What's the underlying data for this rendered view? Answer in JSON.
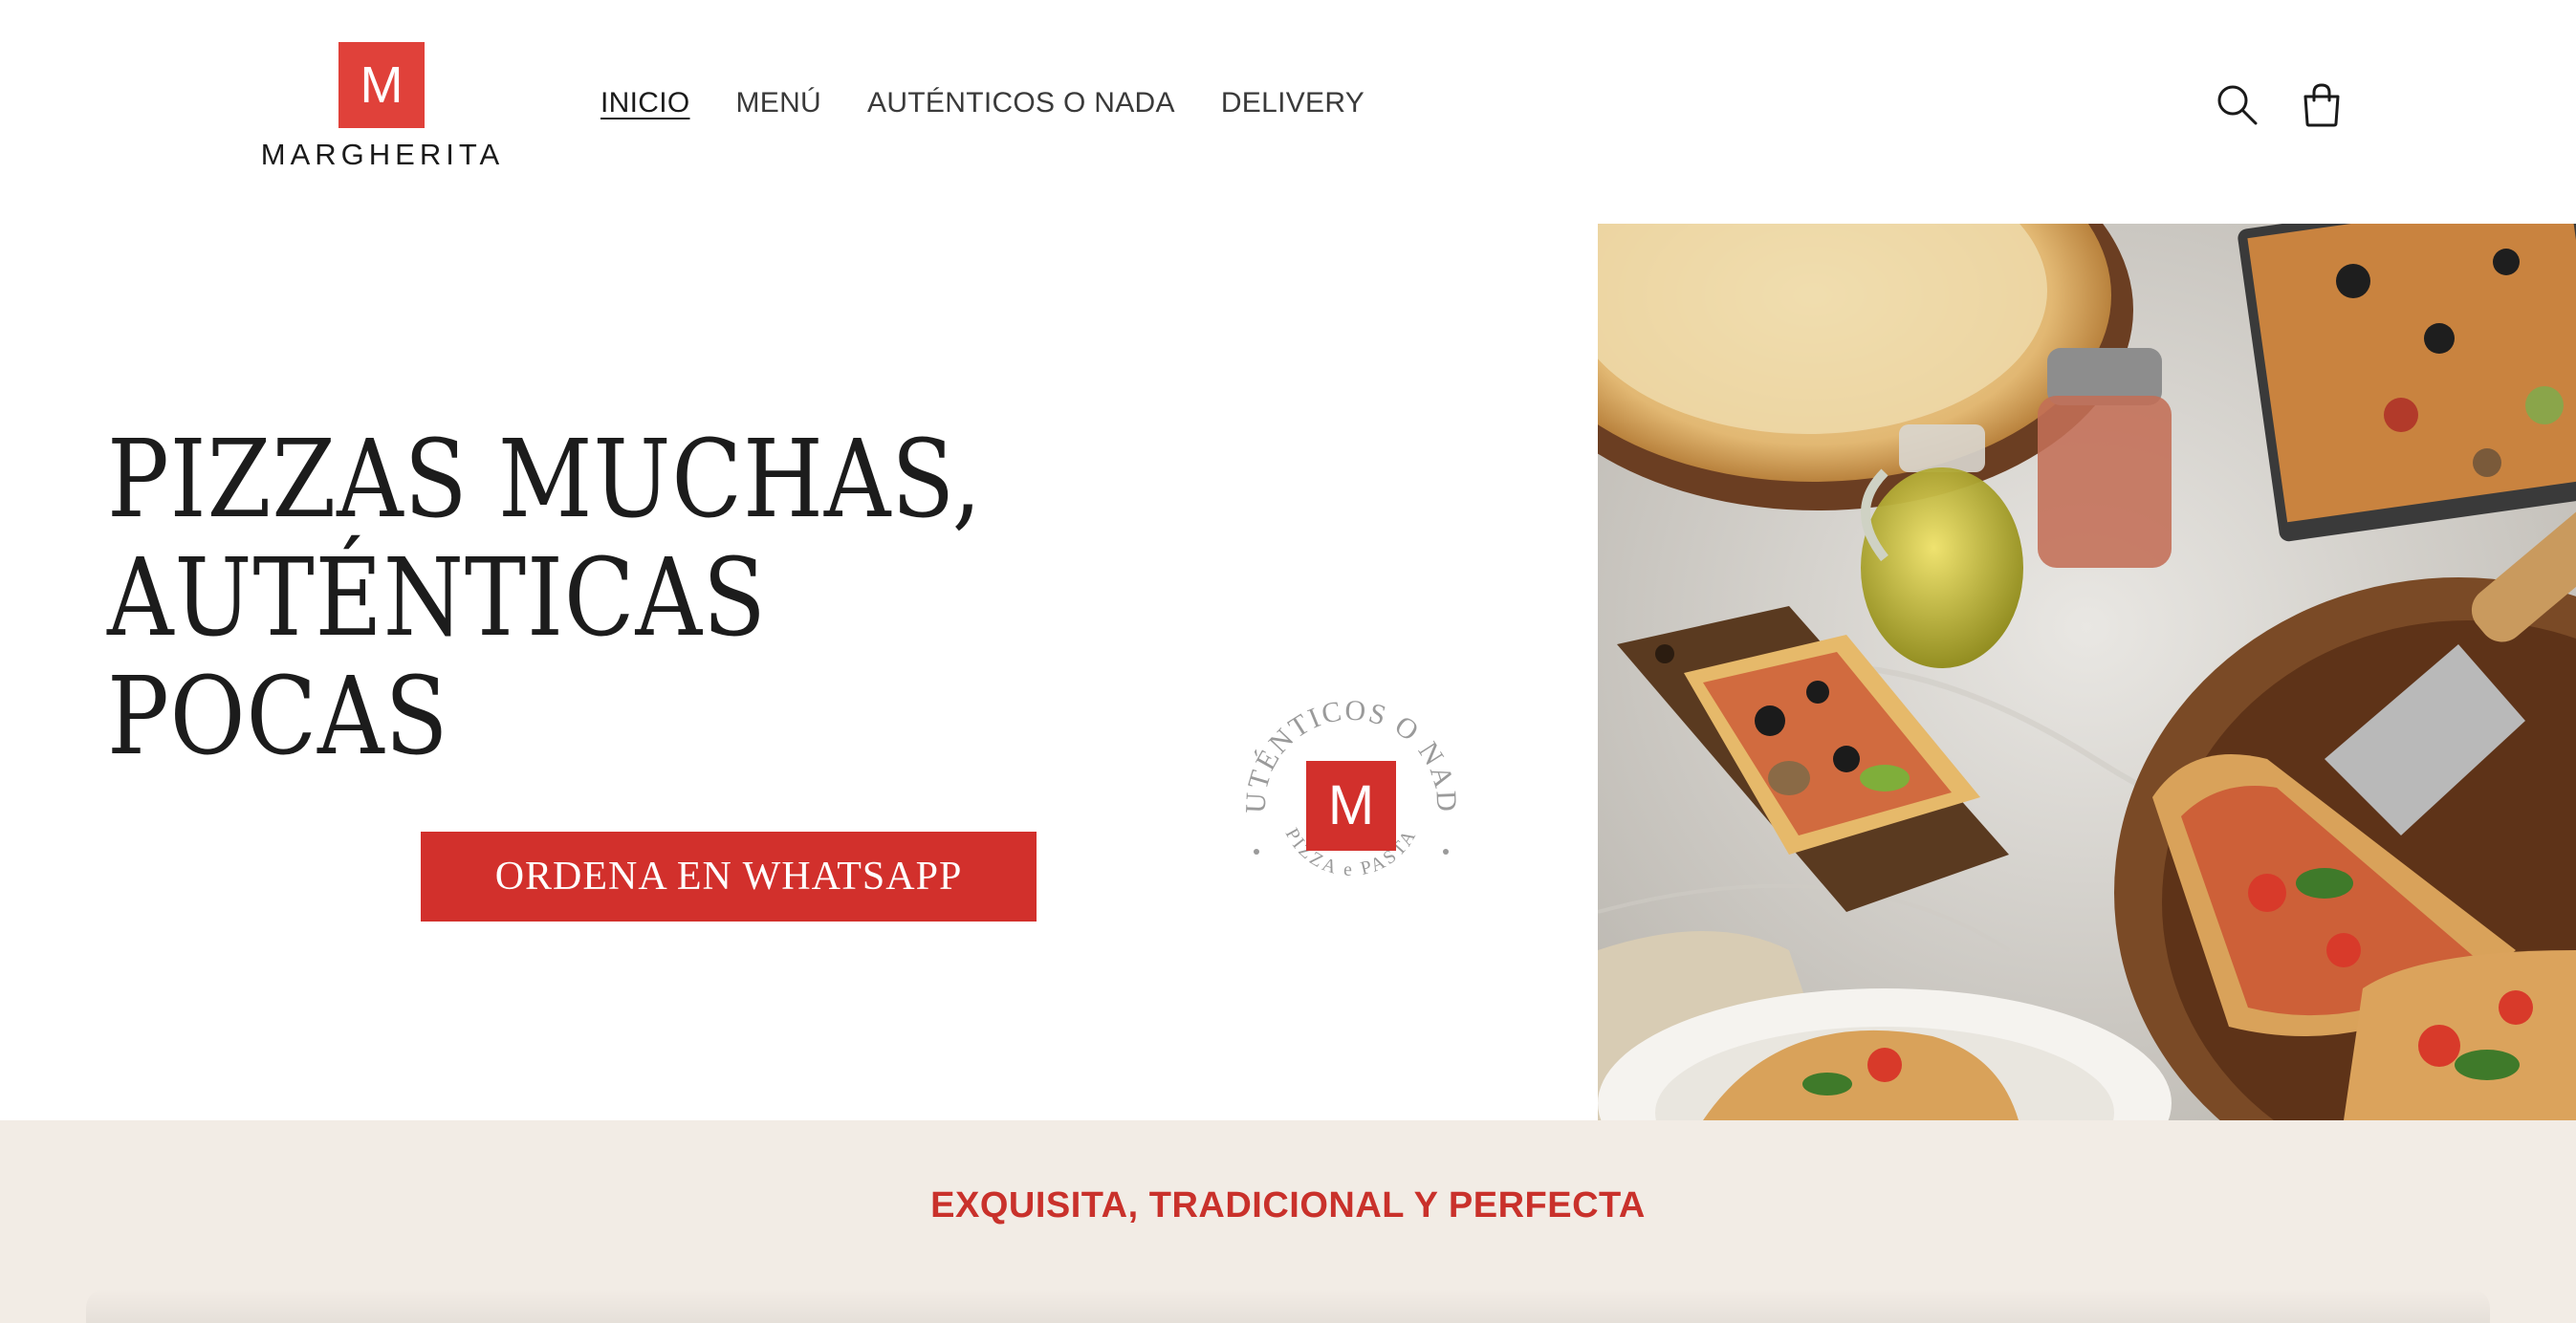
{
  "brand": {
    "logo_letter": "M",
    "name": "MARGHERITA",
    "color": "#e0413a"
  },
  "nav": {
    "items": [
      {
        "label": "INICIO",
        "active": true
      },
      {
        "label": "MENÚ",
        "active": false
      },
      {
        "label": "AUTÉNTICOS O NADA",
        "active": false
      },
      {
        "label": "DELIVERY",
        "active": false
      }
    ]
  },
  "header_icons": {
    "search": "search-icon",
    "cart": "cart-icon"
  },
  "hero": {
    "title_line1": "PIZZAS MUCHAS, AUTÉNTICAS",
    "title_line2": "POCAS",
    "cta_label": "ORDENA EN WHATSAPP",
    "cta_color": "#d2302c"
  },
  "badge": {
    "top_text": "AUTÉNTICOS O NADA",
    "bottom_text": "PIZZA e PASTA",
    "letter": "M"
  },
  "band": {
    "title": "EXQUISITA, TRADICIONAL Y PERFECTA",
    "background": "#f2ece5",
    "title_color": "#c9312b"
  }
}
